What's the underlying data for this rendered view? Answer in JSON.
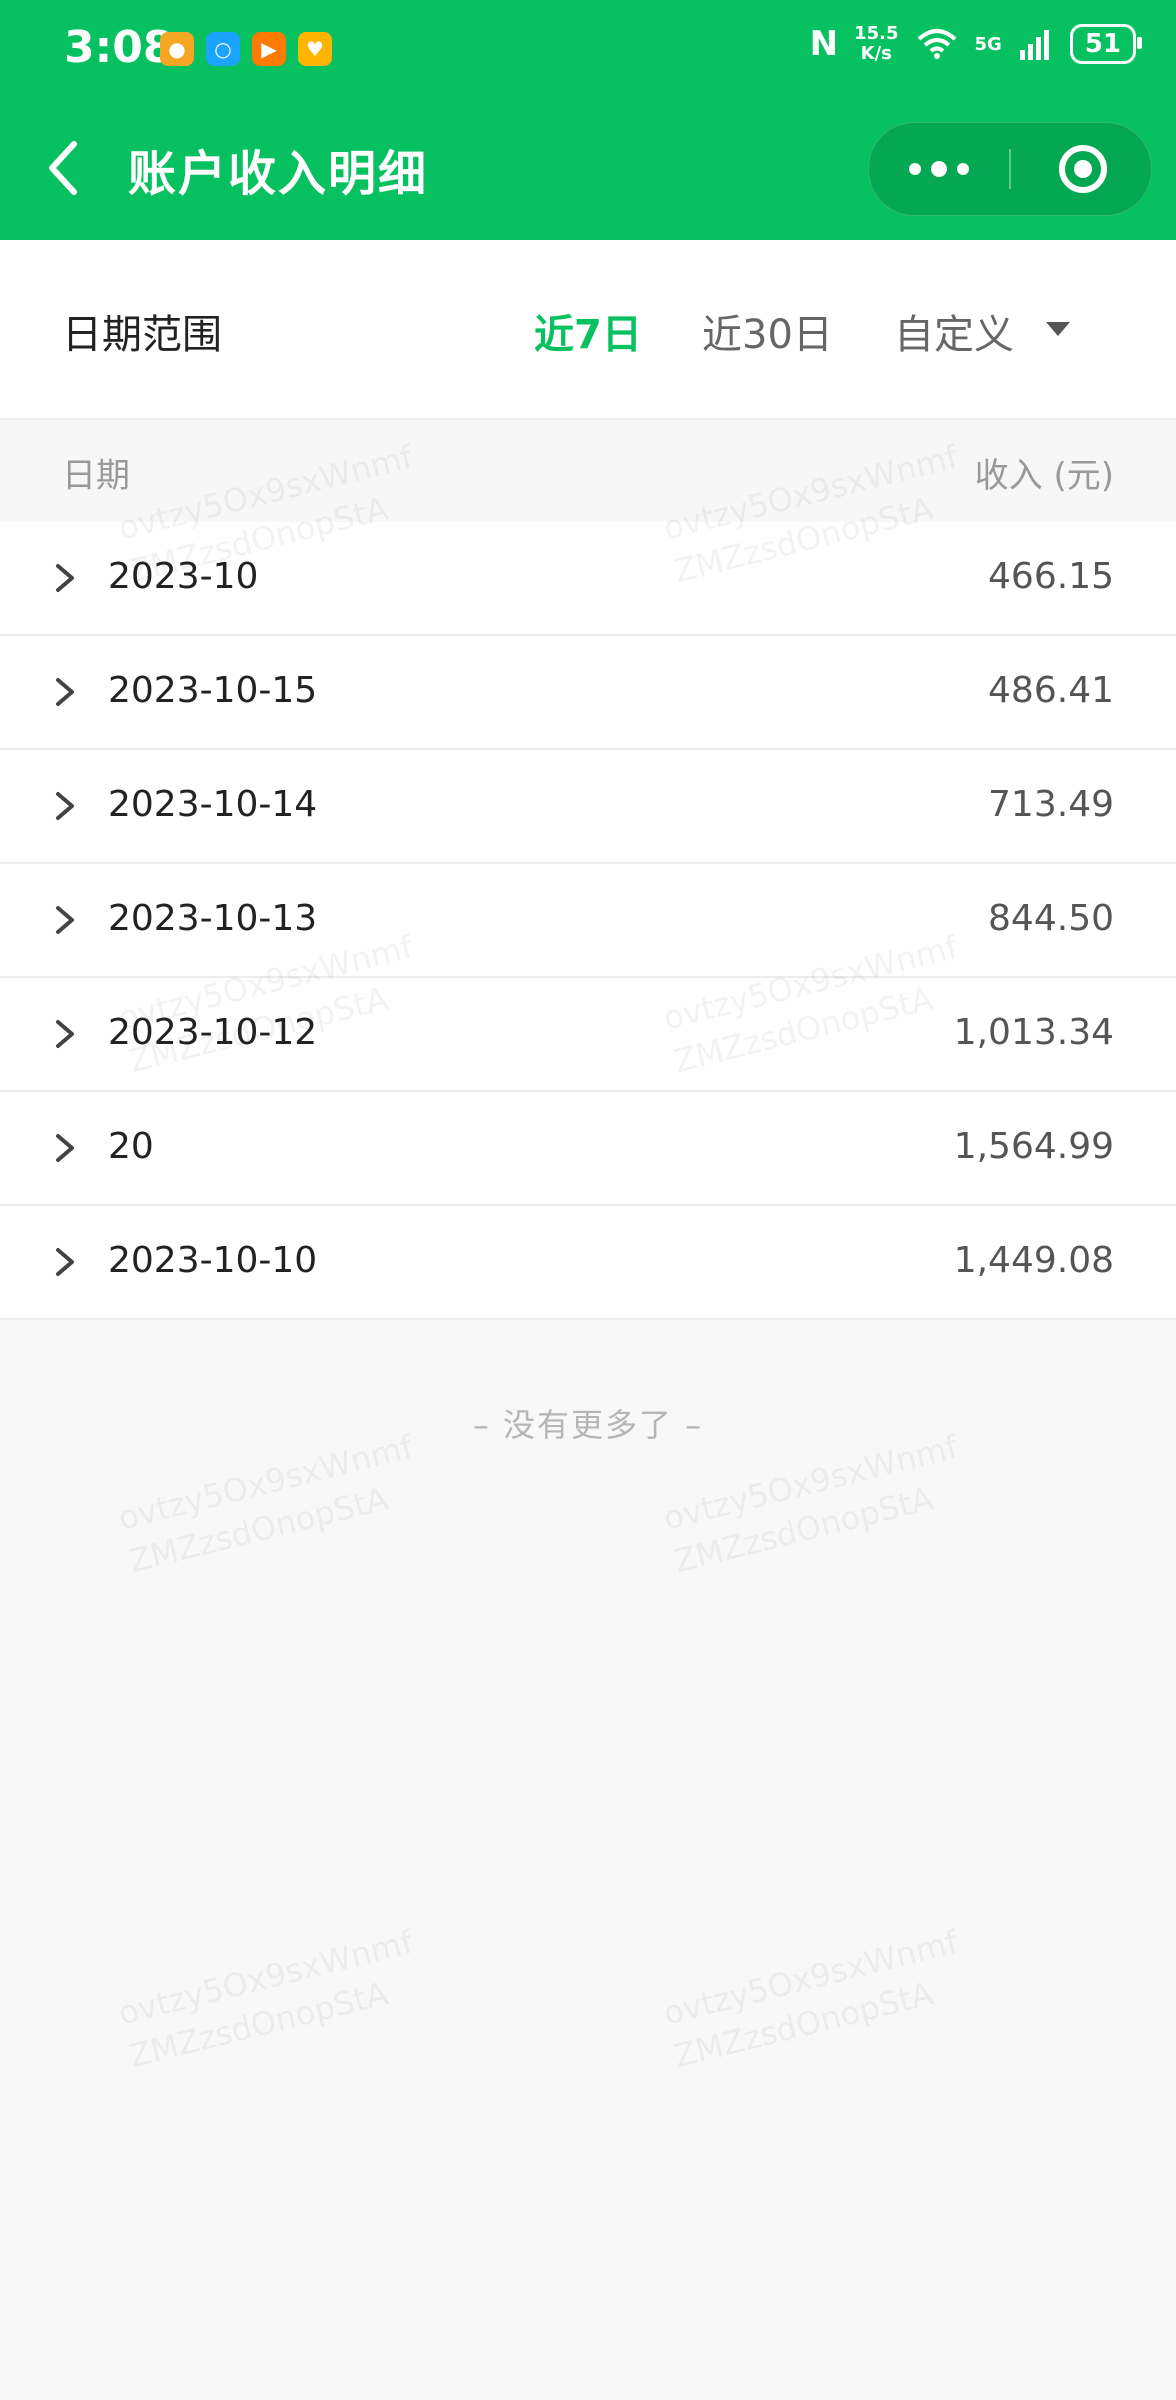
{
  "status_bar": {
    "time": "3:08",
    "speed_top": "15.5",
    "speed_bottom": "K/s",
    "network": "5G",
    "battery": "51"
  },
  "header": {
    "title": "账户收入明细"
  },
  "filter": {
    "label": "日期范围",
    "options": [
      "近7日",
      "近30日",
      "自定义"
    ],
    "selected": "近7日"
  },
  "table": {
    "col_date": "日期",
    "col_income": "收入 (元)",
    "rows": [
      {
        "date": "2023-10",
        "amount": "466.15"
      },
      {
        "date": "2023-10-15",
        "amount": "486.41"
      },
      {
        "date": "2023-10-14",
        "amount": "713.49"
      },
      {
        "date": "2023-10-13",
        "amount": "844.50"
      },
      {
        "date": "2023-10-12",
        "amount": "1,013.34"
      },
      {
        "date": "20",
        "amount": "1,564.99"
      },
      {
        "date": "2023-10-10",
        "amount": "1,449.08"
      }
    ]
  },
  "footer": {
    "no_more": "– 没有更多了 –"
  },
  "watermark": {
    "line1": "ovtzy5Ox9sxWnmf",
    "line2": "ZMZzsdOnopStA"
  },
  "colors": {
    "brand_green": "#07c160"
  }
}
